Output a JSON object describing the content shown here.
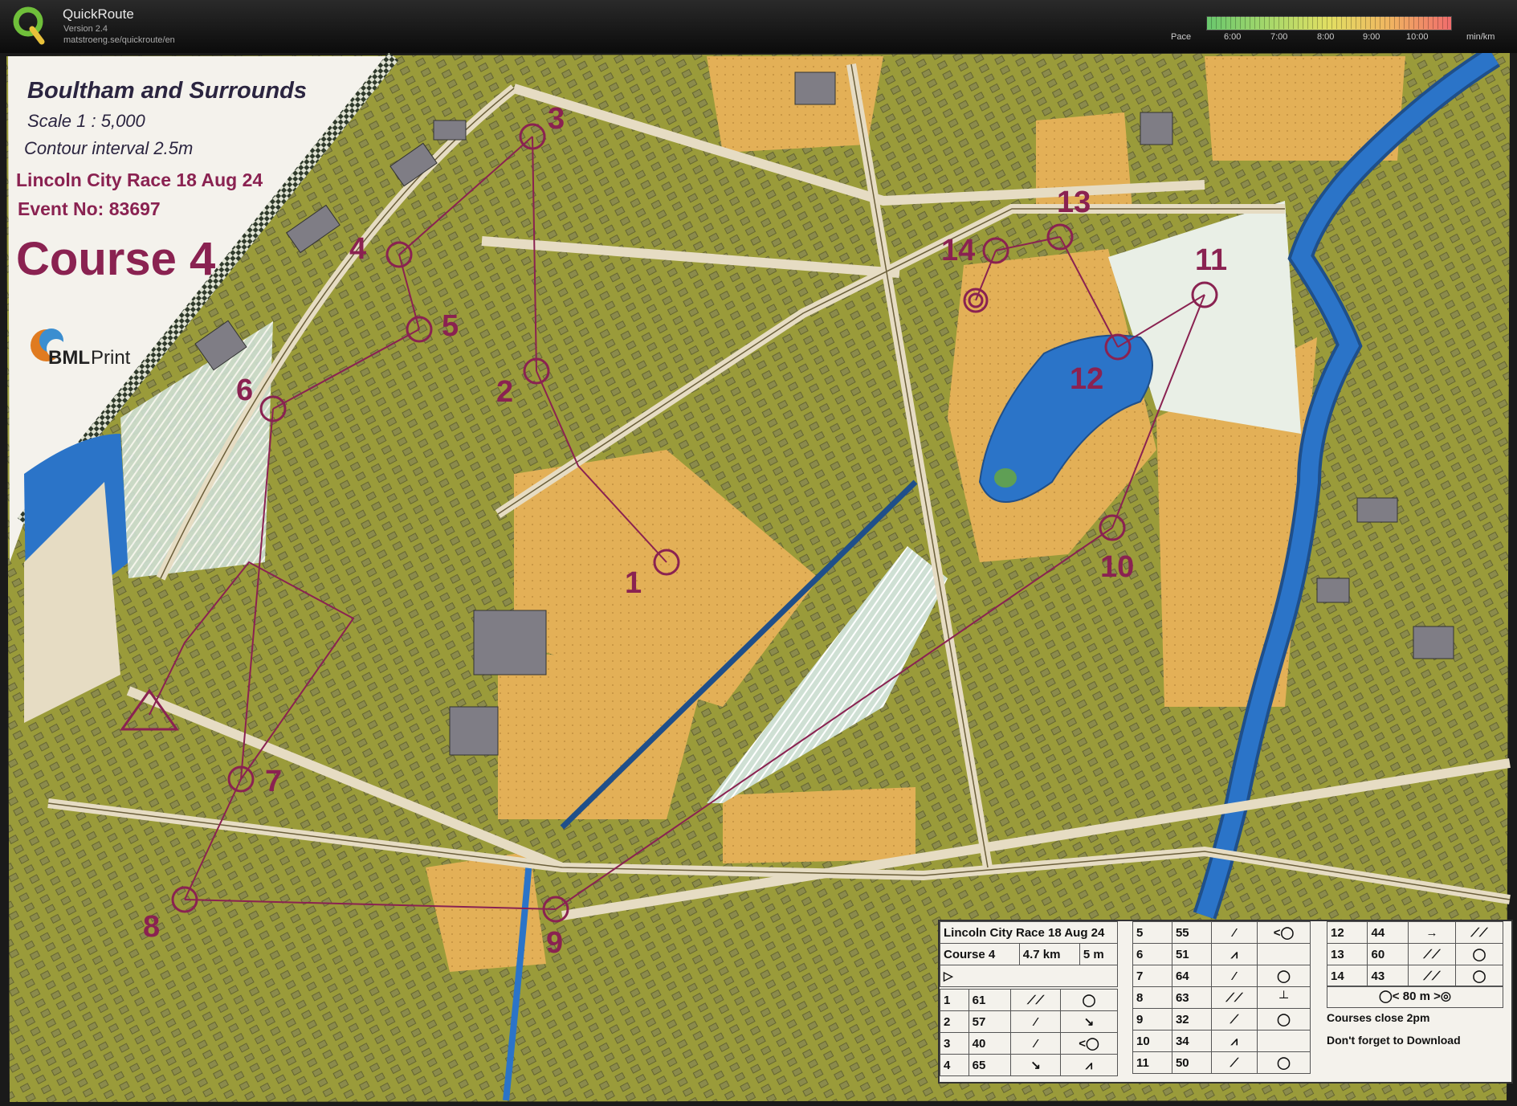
{
  "app": {
    "name": "QuickRoute",
    "version": "Version 2.4",
    "url": "matstroeng.se/quickroute/en",
    "logo_letter": "Q"
  },
  "pace_scale": {
    "label": "Pace",
    "unit": "min/km",
    "ticks": [
      "6:00",
      "7:00",
      "8:00",
      "9:00",
      "10:00"
    ]
  },
  "map": {
    "title": "Boultham and Surrounds",
    "scale": "Scale  1 : 5,000",
    "contour": "Contour interval  2.5m",
    "race": "Lincoln City Race 18 Aug 24",
    "event": "Event No: 83697",
    "course": "Course 4",
    "sponsor_bml": "BML",
    "sponsor_print": "Print",
    "colors": {
      "olive": "#9a9b3a",
      "yellow": "#e3b057",
      "water": "#2b74c8",
      "course": "#8a2251",
      "paper": "#f4f2ec"
    },
    "controls": [
      "1",
      "2",
      "3",
      "4",
      "5",
      "6",
      "7",
      "8",
      "9",
      "10",
      "11",
      "12",
      "13",
      "14"
    ]
  },
  "description_sheet": {
    "header_title": "Lincoln City Race 18 Aug 24",
    "header_course": "Course 4",
    "header_length": "4.7 km",
    "header_climb": "5 m",
    "rows_left": [
      {
        "num": "1",
        "code": "61",
        "c1": "⟋⟋",
        "c2": "◯"
      },
      {
        "num": "2",
        "code": "57",
        "c1": "⁄",
        "c2": "↘"
      },
      {
        "num": "3",
        "code": "40",
        "c1": "⁄",
        "c2": "<◯"
      },
      {
        "num": "4",
        "code": "65",
        "c1": "↘",
        "c2": "⩘"
      }
    ],
    "rows_mid": [
      {
        "num": "5",
        "code": "55",
        "c1": "⁄",
        "c2": "<◯"
      },
      {
        "num": "6",
        "code": "51",
        "c1": "⩘",
        "c2": ""
      },
      {
        "num": "7",
        "code": "64",
        "c1": "⁄",
        "c2": "◯"
      },
      {
        "num": "8",
        "code": "63",
        "c1": "⟋⟋",
        "c2": "┴"
      },
      {
        "num": "9",
        "code": "32",
        "c1": "⟋",
        "c2": "◯"
      },
      {
        "num": "10",
        "code": "34",
        "c1": "⩘",
        "c2": ""
      },
      {
        "num": "11",
        "code": "50",
        "c1": "⟋",
        "c2": "◯"
      }
    ],
    "rows_right": [
      {
        "num": "12",
        "code": "44",
        "c1": "→",
        "c2": "⟋⟋"
      },
      {
        "num": "13",
        "code": "60",
        "c1": "⟋⟋",
        "c2": "◯"
      },
      {
        "num": "14",
        "code": "43",
        "c1": "⟋⟋",
        "c2": "◯"
      }
    ],
    "finish_distance": "80 m",
    "note_close": "Courses close 2pm",
    "note_download": "Don't forget to Download"
  }
}
